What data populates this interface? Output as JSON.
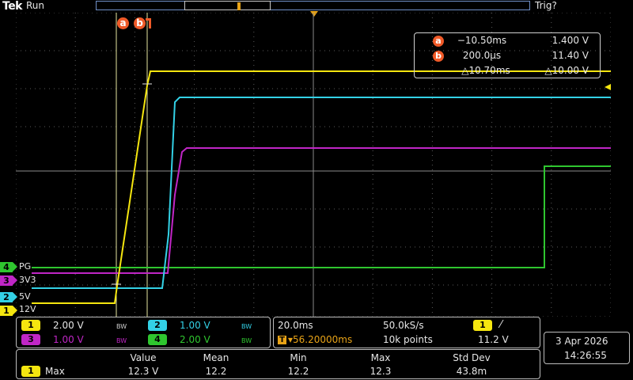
{
  "top_bar": {
    "brand": "Tek",
    "status": "Run",
    "trigger_status": "Trig?"
  },
  "cursors": {
    "a": {
      "label": "a",
      "time": "−10.50ms",
      "voltage": "1.400 V"
    },
    "b": {
      "label": "b",
      "time": "200.0µs",
      "voltage": "11.40 V"
    },
    "delta": {
      "time": "△10.70ms",
      "voltage": "△10.00 V"
    }
  },
  "channels": [
    {
      "num": "1",
      "name": "12V",
      "color": "#f5e60f",
      "scale": "2.00 V",
      "bw": "BW"
    },
    {
      "num": "2",
      "name": "5V",
      "color": "#33d1e6",
      "scale": "1.00 V",
      "bw": "BW"
    },
    {
      "num": "3",
      "name": "3V3",
      "color": "#c026c6",
      "scale": "1.00 V",
      "bw": "BW"
    },
    {
      "num": "4",
      "name": "PG",
      "color": "#2fc62f",
      "scale": "2.00 V",
      "bw": "BW"
    }
  ],
  "timebase": {
    "scale": "20.0ms",
    "sample_rate": "50.0kS/s",
    "position": "▾56.20000ms",
    "record_length": "10k points"
  },
  "trigger": {
    "source": "1",
    "slope": "⁄",
    "level": "11.2 V"
  },
  "measurement": {
    "headers": [
      "Value",
      "Mean",
      "Min",
      "Max",
      "Std Dev"
    ],
    "source": "1",
    "name": "Max",
    "values": [
      "12.3 V",
      "12.2",
      "12.2",
      "12.3",
      "43.8m"
    ]
  },
  "datetime": {
    "date": "3 Apr  2026",
    "time": "14:26:55"
  }
}
